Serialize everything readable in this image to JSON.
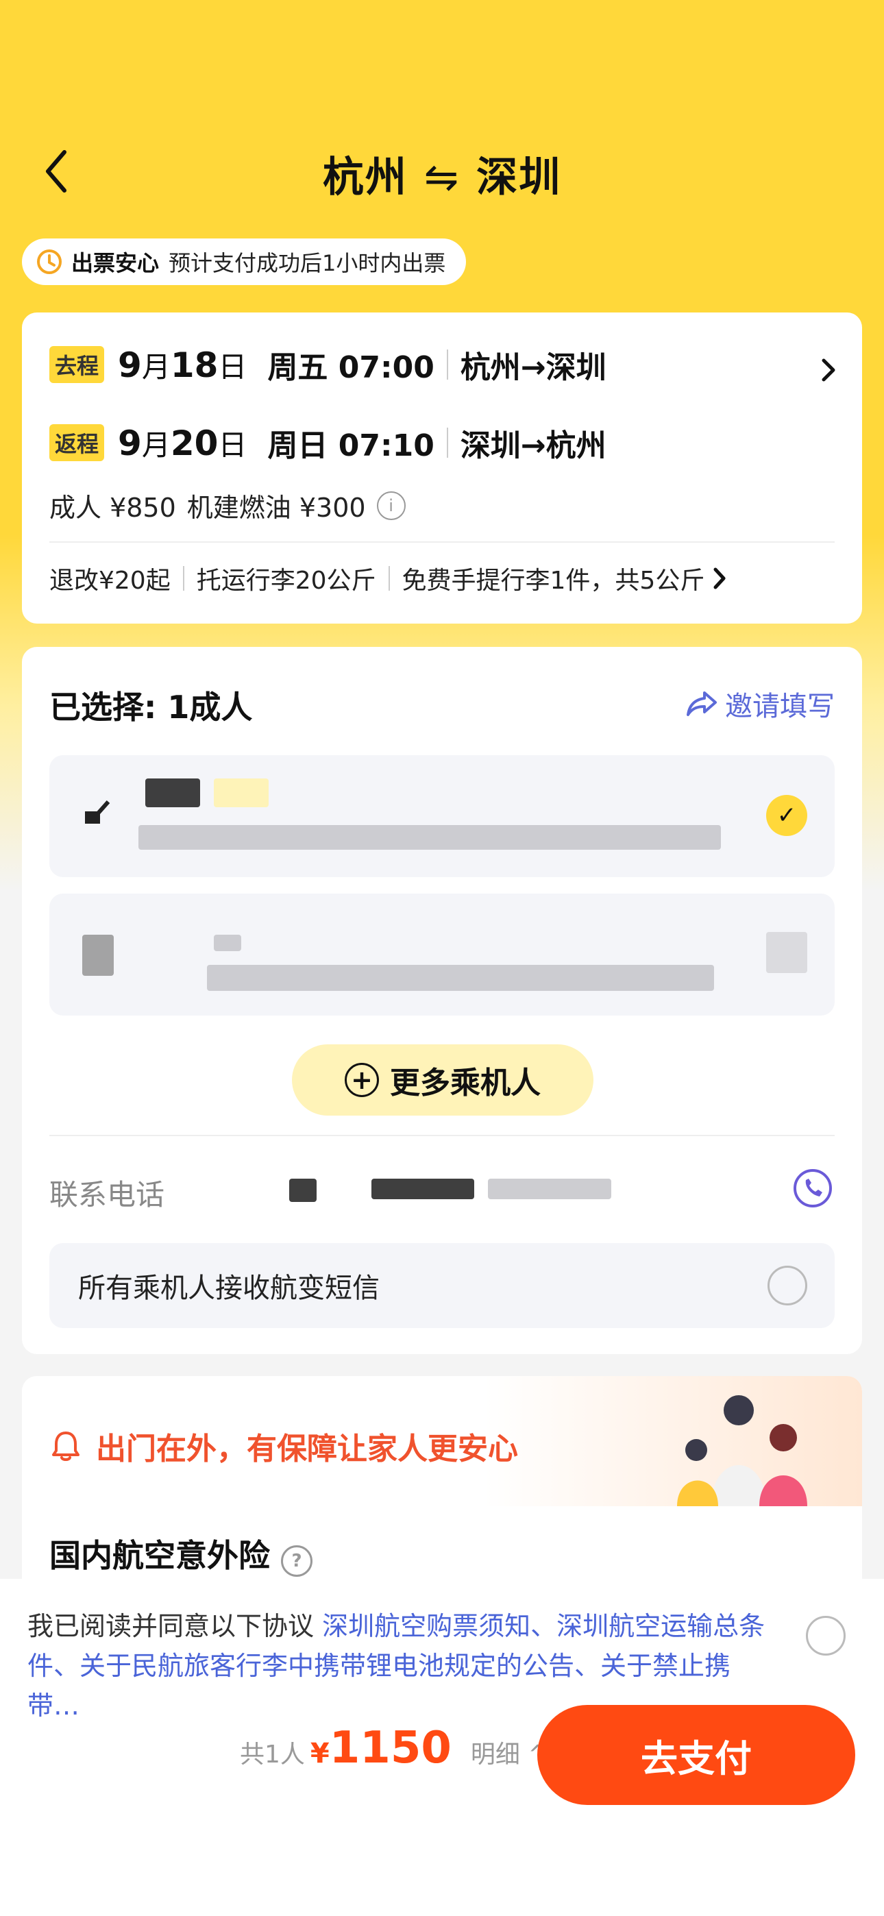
{
  "header": {
    "from_city": "杭州",
    "swap_symbol": "⇋",
    "to_city": "深圳"
  },
  "notice": {
    "bold": "出票安心",
    "text": "预计支付成功后1小时内出票"
  },
  "flights": [
    {
      "tag": "去程",
      "month": "9",
      "month_unit": "月",
      "day": "18",
      "day_unit": "日",
      "weekday_time": "周五 07:00",
      "route": "杭州→深圳"
    },
    {
      "tag": "返程",
      "month": "9",
      "month_unit": "月",
      "day": "20",
      "day_unit": "日",
      "weekday_time": "周日 07:10",
      "route": "深圳→杭州"
    }
  ],
  "price_line": {
    "adult": "成人 ¥850",
    "fuel": "机建燃油 ¥300"
  },
  "baggage": {
    "refund": "退改¥20起",
    "checked": "托运行李20公斤",
    "carry": "免费手提行李1件，共5公斤"
  },
  "passengers": {
    "selected_label": "已选择: 1成人",
    "invite_label": "邀请填写",
    "more_button": "更多乘机人",
    "phone_label": "联系电话",
    "sms_label": "所有乘机人接收航变短信"
  },
  "insurance": {
    "banner_title": "出门在外，有保障让家人更安心",
    "section_title": "国内航空意外险"
  },
  "agreement": {
    "prefix": "我已阅读并同意以下协议",
    "links": "深圳航空购票须知、深圳航空运输总条件、关于民航旅客行李中携带锂电池规定的公告、关于禁止携带…"
  },
  "checkout": {
    "count": "共1人",
    "currency": "¥",
    "amount": "1150",
    "detail": "明细",
    "detail_arrow": "^",
    "pay_button": "去支付"
  },
  "colors": {
    "brand_yellow": "#FFD83A",
    "pay_orange": "#FF4A12",
    "link_blue": "#4A64D8",
    "alert_red": "#F0522D"
  }
}
